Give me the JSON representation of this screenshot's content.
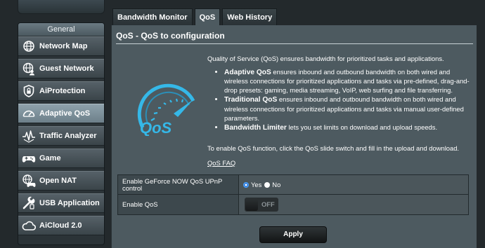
{
  "colors": {
    "background": "#23292c",
    "panel": "#4d5a60",
    "menu_active": "#8fa2ac",
    "logo_blue": "#35b8e8",
    "radio_selected": "#1f6fd6"
  },
  "sidebar": {
    "setup_label": "",
    "section_title": "General",
    "items": [
      {
        "label": "Network Map",
        "icon": "globe-network-icon",
        "active": false
      },
      {
        "label": "Guest Network",
        "icon": "guest-globe-icon",
        "active": false
      },
      {
        "label": "AiProtection",
        "icon": "shield-lock-icon",
        "active": false
      },
      {
        "label": "Adaptive QoS",
        "icon": "speedometer-icon",
        "active": true
      },
      {
        "label": "Traffic Analyzer",
        "icon": "pulse-icon",
        "active": false
      },
      {
        "label": "Game",
        "icon": "gamepad-icon",
        "active": false
      },
      {
        "label": "Open NAT",
        "icon": "globe-gamepad-icon",
        "active": false
      },
      {
        "label": "USB Application",
        "icon": "usb-wrench-icon",
        "active": false
      },
      {
        "label": "AiCloud 2.0",
        "icon": "cloud-icon",
        "active": false
      }
    ]
  },
  "tabs": [
    {
      "label": "Bandwidth Monitor",
      "active": false
    },
    {
      "label": "QoS",
      "active": true
    },
    {
      "label": "Web History",
      "active": false
    }
  ],
  "main": {
    "title": "QoS - QoS to configuration",
    "logo_text": "QoS",
    "intro": "Quality of Service (QoS) ensures bandwidth for prioritized tasks and applications.",
    "bullets": [
      {
        "bold": "Adaptive QoS",
        "text": " ensures inbound and outbound bandwidth on both wired and wireless connections for prioritized applications and tasks via pre-defined, drag-and-drop presets: gaming, media streaming, VoIP, web surfing and file transferring."
      },
      {
        "bold": "Traditional QoS",
        "text": " ensures inbound and outbound bandwidth on both wired and wireless connections for prioritized applications and tasks via manual user-defined parameters."
      },
      {
        "bold": "Bandwidth Limiter",
        "text": " lets you set limits on download and upload speeds."
      }
    ],
    "enable_instructions": "To enable QoS function, click the QoS slide switch and fill in the upload and download.",
    "faq_link": "QoS FAQ",
    "settings": {
      "geforce_label": "Enable GeForce NOW QoS UPnP control",
      "yes_label": "Yes",
      "no_label": "No",
      "geforce_value": "Yes",
      "enable_qos_label": "Enable QoS",
      "enable_qos_state": "OFF"
    },
    "apply_label": "Apply"
  }
}
